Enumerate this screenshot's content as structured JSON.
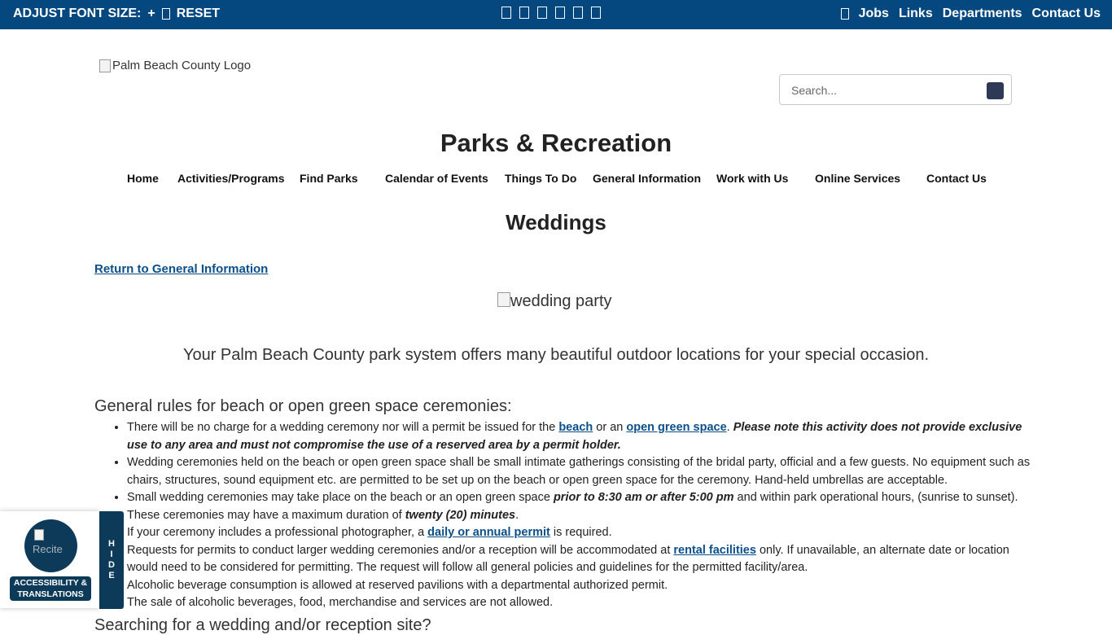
{
  "topbar": {
    "font_size_label": "ADJUST FONT SIZE:",
    "increase": "+",
    "reset": "RESET",
    "links": [
      "Jobs",
      "Links",
      "Departments",
      "Contact Us"
    ]
  },
  "header": {
    "logo_alt": "Palm Beach County Logo",
    "search_placeholder": "Search...",
    "site_title": "Parks & Recreation"
  },
  "nav": [
    "Home",
    "Activities/Programs",
    "Find Parks",
    "Calendar of Events",
    "Things To Do",
    "General Information",
    "Work with Us",
    "Online Services",
    "Contact Us"
  ],
  "page": {
    "title": "Weddings",
    "return_link": "Return to General Information",
    "hero_alt": "wedding party",
    "intro": "Your Palm Beach County park system offers many beautiful outdoor locations for your special occasion.",
    "rules_heading": "General rules for beach or open green space ceremonies:",
    "rules": {
      "r1_a": "There will be no charge for a wedding ceremony nor will a permit be issued for the ",
      "r1_link1": "beach",
      "r1_b": " or an ",
      "r1_link2": "open green space",
      "r1_c": ". ",
      "r1_note": "Please note this activity does not provide exclusive use to any area and must not compromise the use of a reserved area by a permit holder.",
      "r2": "Wedding ceremonies held on the beach or open green space shall be small intimate gatherings consisting of the bridal party, official and a few guests. No equipment such as chairs, structures, sound equipment etc. are permitted to be set up on the beach or open green space for the ceremony. Hand-held umbrellas are acceptable.",
      "r3_a": "Small wedding ceremonies may take place on the beach or an open green space ",
      "r3_time": "prior to 8:30 am or after 5:00 pm",
      "r3_b": " and within park operational hours, (sunrise to sunset). These ceremonies may have a maximum duration of ",
      "r3_dur": "twenty (20) minutes",
      "r3_c": ".",
      "r4_a": "If your ceremony includes a professional photographer, a ",
      "r4_link": "daily or annual permit",
      "r4_b": " is required.",
      "r5_a": "Requests for permits to conduct larger wedding ceremonies and/or a reception will be accommodated at ",
      "r5_link": "rental facilities",
      "r5_b": " only. If unavailable, an alternate date or location would need to be considered for permitting. The request will follow all general policies and guidelines for the permitted facility/area.",
      "r6": "Alcoholic beverage consumption is allowed at reserved pavilions with a departmental authorized permit.",
      "r7": "The sale of alcoholic beverages, food, merchandise and services are not allowed."
    },
    "next_heading": "Searching for a wedding and/or reception site?"
  },
  "a11y": {
    "icon_alt": "Recite",
    "label": "ACCESSIBILITY & TRANSLATIONS",
    "hide": [
      "H",
      "I",
      "D",
      "E"
    ]
  }
}
